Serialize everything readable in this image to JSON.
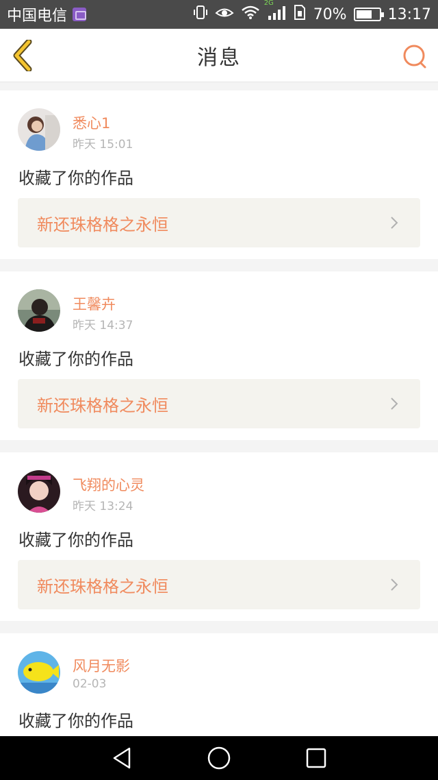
{
  "status_bar": {
    "carrier": "中国电信",
    "network": "2G",
    "battery_percent": "70%",
    "battery_level": 0.7,
    "time": "13:17",
    "icons": [
      "vibrate-icon",
      "eye-comfort-icon",
      "wifi-icon",
      "signal-icon",
      "sim-icon",
      "battery-icon"
    ]
  },
  "header": {
    "title": "消息",
    "back_icon": "chevron-left-icon",
    "search_icon": "search-icon"
  },
  "colors": {
    "accent": "#f08a5d",
    "back_icon": "#f4c430",
    "text": "#333333",
    "muted": "#b5b5b5",
    "card_link_bg": "#f4f3ee"
  },
  "messages": [
    {
      "username": "悉心1",
      "time": "昨天 15:01",
      "action": "收藏了你的作品",
      "work_title": "新还珠格格之永恒",
      "avatar": "avatar-photo"
    },
    {
      "username": "王馨卉",
      "time": "昨天 14:37",
      "action": "收藏了你的作品",
      "work_title": "新还珠格格之永恒",
      "avatar": "avatar-photo"
    },
    {
      "username": "飞翔的心灵",
      "time": "昨天 13:24",
      "action": "收藏了你的作品",
      "work_title": "新还珠格格之永恒",
      "avatar": "avatar-photo"
    },
    {
      "username": "风月无影",
      "time": "02-03",
      "action": "收藏了你的作品",
      "work_title": "",
      "avatar": "avatar-photo"
    }
  ],
  "nav_bar": {
    "icons": [
      "back-triangle-icon",
      "home-circle-icon",
      "recents-square-icon"
    ]
  }
}
